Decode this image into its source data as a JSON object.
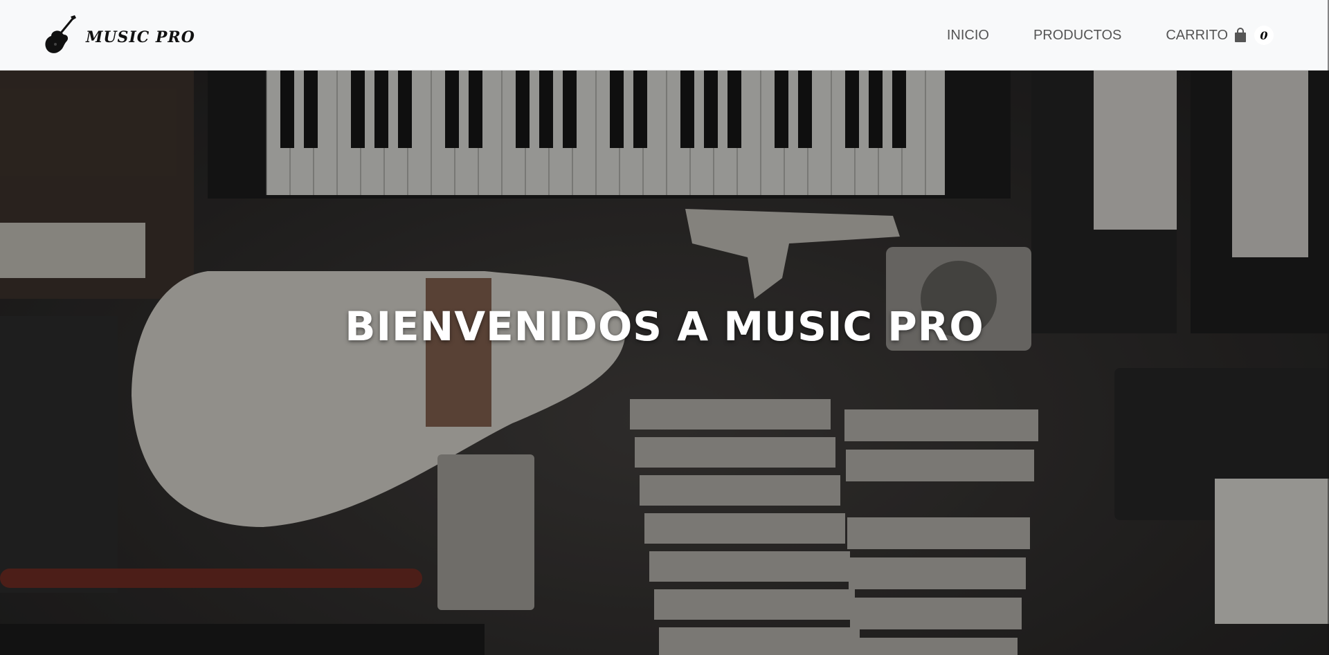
{
  "brand": {
    "name": "MUSIC PRO",
    "logo_icon": "electric-guitar-icon"
  },
  "nav": {
    "items": [
      {
        "label": "INICIO"
      },
      {
        "label": "PRODUCTOS"
      },
      {
        "label": "CARRITO"
      }
    ],
    "cart_icon": "shopping-bag-icon",
    "cart_count": "0"
  },
  "hero": {
    "title": "BIENVENIDOS A MUSIC PRO"
  },
  "colors": {
    "navbar_bg": "#f8f9fa",
    "nav_text": "#555555",
    "hero_text": "#ffffff"
  }
}
